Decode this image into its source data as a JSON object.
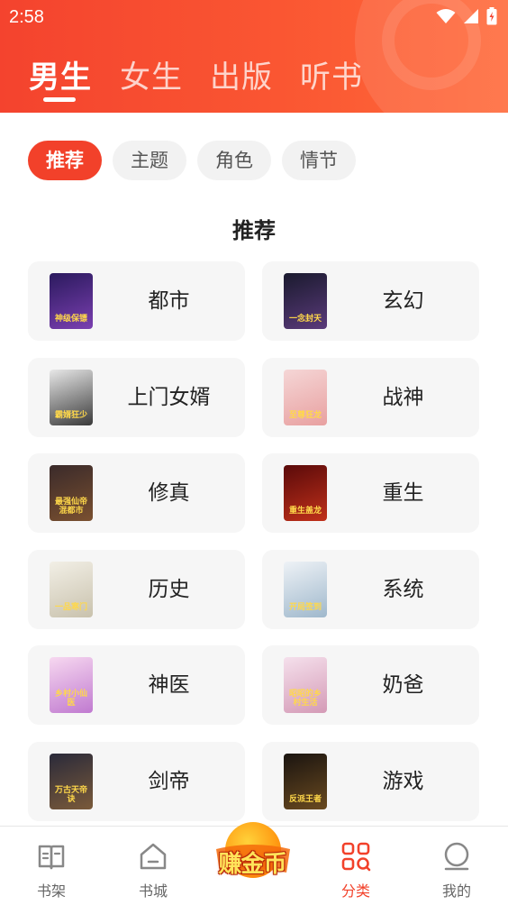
{
  "status_bar": {
    "time": "2:58"
  },
  "top_tabs": [
    {
      "label": "男生",
      "active": true
    },
    {
      "label": "女生",
      "active": false
    },
    {
      "label": "出版",
      "active": false
    },
    {
      "label": "听书",
      "active": false
    }
  ],
  "filter_chips": [
    {
      "label": "推荐",
      "active": true
    },
    {
      "label": "主题",
      "active": false
    },
    {
      "label": "角色",
      "active": false
    },
    {
      "label": "情节",
      "active": false
    }
  ],
  "section_title": "推荐",
  "categories": [
    {
      "label": "都市",
      "cover_text": "神级保镖",
      "cover_colors": [
        "#2b1a5e",
        "#7a3fb0"
      ]
    },
    {
      "label": "玄幻",
      "cover_text": "一念封天",
      "cover_colors": [
        "#1a1a2e",
        "#5a3a7a"
      ]
    },
    {
      "label": "上门女婿",
      "cover_text": "霸婿狂少",
      "cover_colors": [
        "#e8e8e8",
        "#3a3a3a"
      ]
    },
    {
      "label": "战神",
      "cover_text": "至尊狂龙",
      "cover_colors": [
        "#f5d6d6",
        "#e8a0a0"
      ]
    },
    {
      "label": "修真",
      "cover_text": "最强仙帝混都市",
      "cover_colors": [
        "#3a2a2a",
        "#7a5030"
      ]
    },
    {
      "label": "重生",
      "cover_text": "重生盖龙",
      "cover_colors": [
        "#5a0a0a",
        "#c0301a"
      ]
    },
    {
      "label": "历史",
      "cover_text": "一品寒门",
      "cover_colors": [
        "#f2efe6",
        "#c9c2ad"
      ]
    },
    {
      "label": "系统",
      "cover_text": "开局签到",
      "cover_colors": [
        "#eef2f6",
        "#9fb8cc"
      ]
    },
    {
      "label": "神医",
      "cover_text": "乡村小仙医",
      "cover_colors": [
        "#f7d8f0",
        "#c07ad0"
      ]
    },
    {
      "label": "奶爸",
      "cover_text": "昭昭的乡村生活",
      "cover_colors": [
        "#f5e0ec",
        "#d49ab6"
      ]
    },
    {
      "label": "剑帝",
      "cover_text": "万古天帝诀",
      "cover_colors": [
        "#2a2a3a",
        "#7a5a3a"
      ]
    },
    {
      "label": "游戏",
      "cover_text": "反派王者",
      "cover_colors": [
        "#1a1410",
        "#6a4a20"
      ]
    }
  ],
  "bottom_nav": [
    {
      "label": "书架",
      "icon": "bookshelf-icon",
      "active": false
    },
    {
      "label": "书城",
      "icon": "home-icon",
      "active": false
    },
    {
      "label": "分类",
      "icon": "category-grid-icon",
      "active": true
    },
    {
      "label": "我的",
      "icon": "profile-icon",
      "active": false
    }
  ],
  "earn_coins": {
    "label": "赚金币"
  },
  "colors": {
    "accent": "#f2412a",
    "header_gradient_start": "#f4432e",
    "header_gradient_end": "#ff6a3a",
    "card_bg": "#f6f6f6"
  }
}
